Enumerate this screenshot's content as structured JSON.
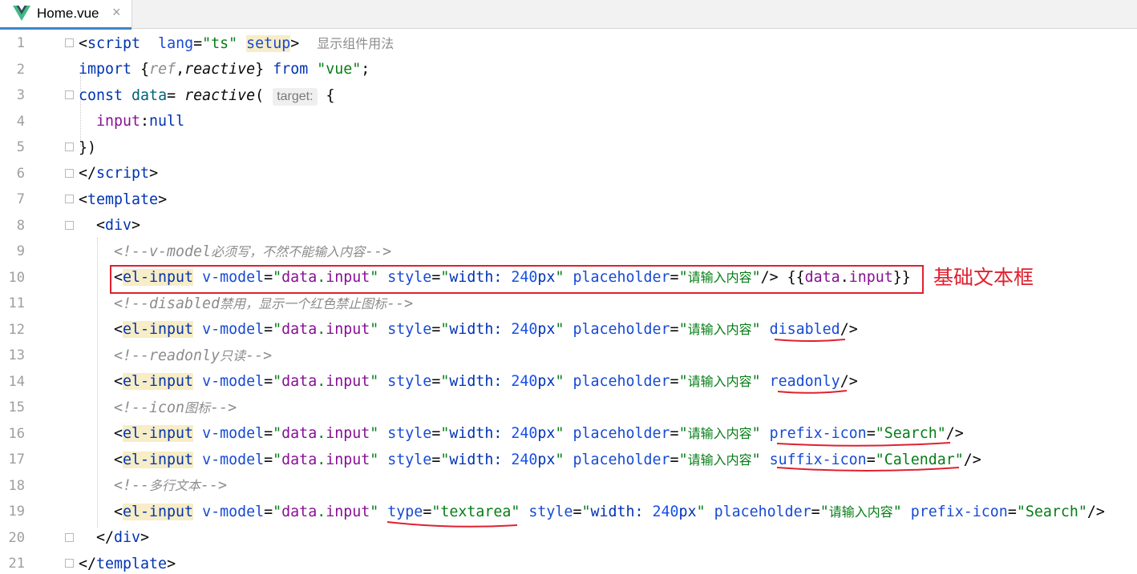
{
  "tab": {
    "title": "Home.vue",
    "close": "×",
    "icon": "vue-logo-icon"
  },
  "line_numbers": [
    "1",
    "2",
    "3",
    "4",
    "5",
    "6",
    "7",
    "8",
    "9",
    "10",
    "11",
    "12",
    "13",
    "14",
    "15",
    "16",
    "17",
    "18",
    "19",
    "20",
    "21"
  ],
  "code": {
    "l1": {
      "open": "<",
      "tag": "script",
      "a1": "lang",
      "eq": "=",
      "v1": "\"ts\"",
      "setup": "setup",
      "close": ">",
      "hint": "显示组件用法"
    },
    "l2": {
      "imp": "import",
      "lb": " {",
      "ref": "ref",
      "comma": ",",
      "reactive": "reactive",
      "rb": "}",
      "from": "from",
      "mod": "\"vue\"",
      "semi": ";"
    },
    "l3": {
      "const": "const",
      "data": "data",
      "eq": "= ",
      "reactive": "reactive",
      "paren": "(",
      "param": "target:",
      "brace": " {"
    },
    "l4": {
      "key": "input",
      "colon": ":",
      "val": "null"
    },
    "l5": {
      "text": "})"
    },
    "l6": {
      "open": "</",
      "tag": "script",
      "close": ">"
    },
    "l7": {
      "open": "<",
      "tag": "template",
      "close": ">"
    },
    "l8": {
      "open": "<",
      "tag": "div",
      "close": ">"
    },
    "l9": {
      "pre": "<!--v-model",
      "cjk": "必须写，不然不能输入内容",
      "post": "-->"
    },
    "l11": {
      "pre": "<!--disabled",
      "cjk": "禁用，显示一个红色禁止图标",
      "post": "-->"
    },
    "l13": {
      "pre": "<!--readonly",
      "cjk": "只读",
      "post": "-->"
    },
    "l15": {
      "pre": "<!--icon",
      "cjk": "图标",
      "post": "-->"
    },
    "l17c": {
      "pre": "<!--",
      "cjk": "多行文本",
      "post": "-->"
    },
    "input_common": {
      "lt": "<",
      "tag": "el-input",
      "vm": "v-model",
      "eq": "=",
      "q": "\"",
      "data": "data",
      "dot": ".",
      "input": "input",
      "style": "style",
      "width": "width: ",
      "num": "240",
      "px": "px",
      "ph": "placeholder",
      "ph_val": "请输入内容"
    },
    "l10": {
      "end": "/>",
      "mus_open": "{{",
      "data": "data",
      "dot": ".",
      "input": "input",
      "mus_close": "}}"
    },
    "l12": {
      "extra": "disabled",
      "end": "/>"
    },
    "l14": {
      "extra": "readonly",
      "end": "/>"
    },
    "l16": {
      "attr": "prefix-icon",
      "val": "\"Search\"",
      "end": "/>"
    },
    "l17": {
      "attr": "suffix-icon",
      "val": "\"Calendar\"",
      "end": "/>"
    },
    "l19": {
      "type": "type",
      "type_val": "\"textarea\"",
      "attr2": "prefix-icon",
      "val2": "\"Search\"",
      "end": "/>"
    },
    "l20": {
      "open": "</",
      "tag": "div",
      "close": ">"
    },
    "l21": {
      "open": "</",
      "tag": "template",
      "close": ">"
    }
  },
  "annotation": {
    "label": "基础文本框",
    "color": "#e0202f"
  }
}
